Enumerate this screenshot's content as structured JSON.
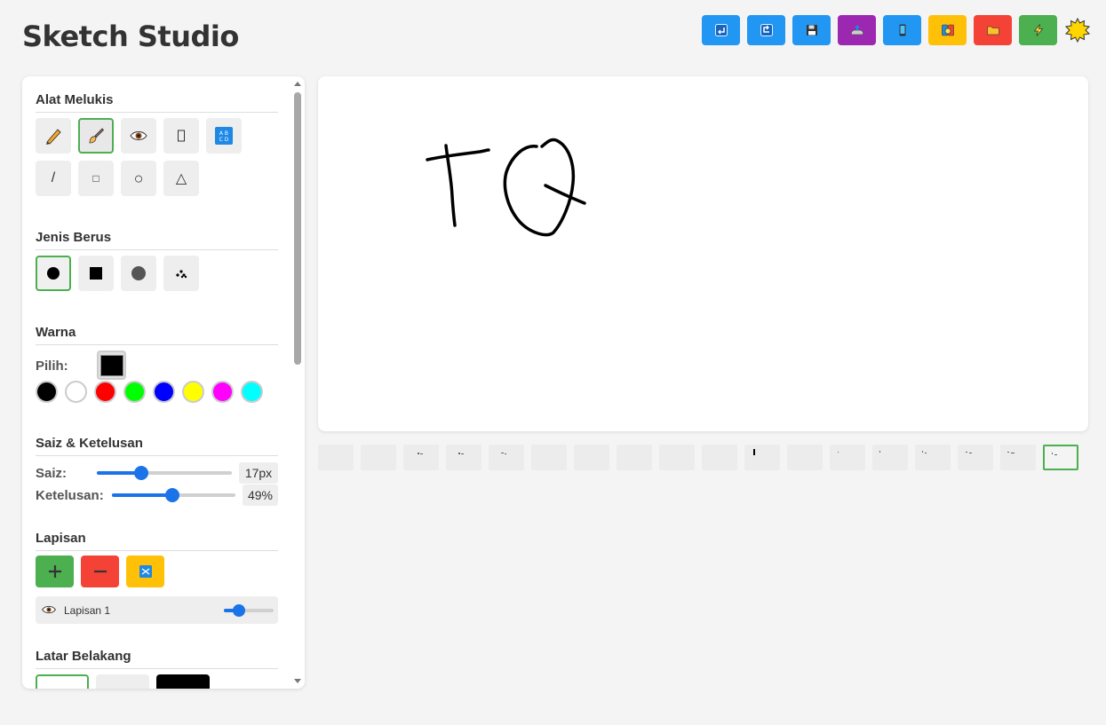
{
  "app": {
    "title": "Sketch Studio"
  },
  "toolbar": {
    "buttons": [
      {
        "name": "undo",
        "icon": "undo-icon",
        "color": "#2196f3"
      },
      {
        "name": "redo",
        "icon": "redo-icon",
        "color": "#2196f3"
      },
      {
        "name": "save",
        "icon": "floppy-disk-icon",
        "color": "#2196f3"
      },
      {
        "name": "export",
        "icon": "tray-upload-icon",
        "color": "#9c27b0"
      },
      {
        "name": "mobile",
        "icon": "mobile-phone-icon",
        "color": "#2196f3"
      },
      {
        "name": "palette",
        "icon": "palette-icon",
        "color": "#ffc107"
      },
      {
        "name": "open",
        "icon": "folder-icon",
        "color": "#f44336"
      },
      {
        "name": "quick",
        "icon": "lightning-icon",
        "color": "#4caf50"
      }
    ],
    "theme_icon": "sun-icon"
  },
  "sidebar": {
    "tools": {
      "title": "Alat Melukis",
      "items": [
        {
          "name": "pencil",
          "icon": "pencil-icon"
        },
        {
          "name": "brush",
          "icon": "paintbrush-icon",
          "active": true
        },
        {
          "name": "view",
          "icon": "eye-icon"
        },
        {
          "name": "eraser",
          "icon": "eraser-icon"
        },
        {
          "name": "text",
          "icon": "abcd-icon"
        },
        {
          "name": "line",
          "glyph": "/"
        },
        {
          "name": "rectangle",
          "glyph": "□"
        },
        {
          "name": "circle",
          "glyph": "○"
        },
        {
          "name": "triangle",
          "glyph": "△"
        }
      ]
    },
    "brush_types": {
      "title": "Jenis Berus",
      "items": [
        "round",
        "square",
        "soft",
        "spray"
      ],
      "active": "round"
    },
    "color": {
      "title": "Warna",
      "pick_label": "Pilih:",
      "current": "#000000",
      "presets": [
        "#000000",
        "#ffffff",
        "#ff0000",
        "#00ff00",
        "#0000ff",
        "#ffff00",
        "#ff00ff",
        "#00ffff"
      ]
    },
    "size_opacity": {
      "title": "Saiz & Ketelusan",
      "size_label": "Saiz:",
      "size_value": "17px",
      "size_fraction": 0.33,
      "opacity_label": "Ketelusan:",
      "opacity_value": "49%",
      "opacity_fraction": 0.49
    },
    "layers": {
      "title": "Lapisan",
      "items": [
        {
          "name": "Lapisan 1",
          "visible": true,
          "opacity_fraction": 0.3
        }
      ]
    },
    "background": {
      "title": "Latar Belakang",
      "options": [
        "#ffffff",
        "#eeeeee",
        "#000000"
      ],
      "active": "#ffffff"
    }
  },
  "canvas": {
    "drawing": "TQ",
    "stroke_color": "#000000"
  },
  "frames": {
    "count": 18,
    "active_index": 17
  }
}
